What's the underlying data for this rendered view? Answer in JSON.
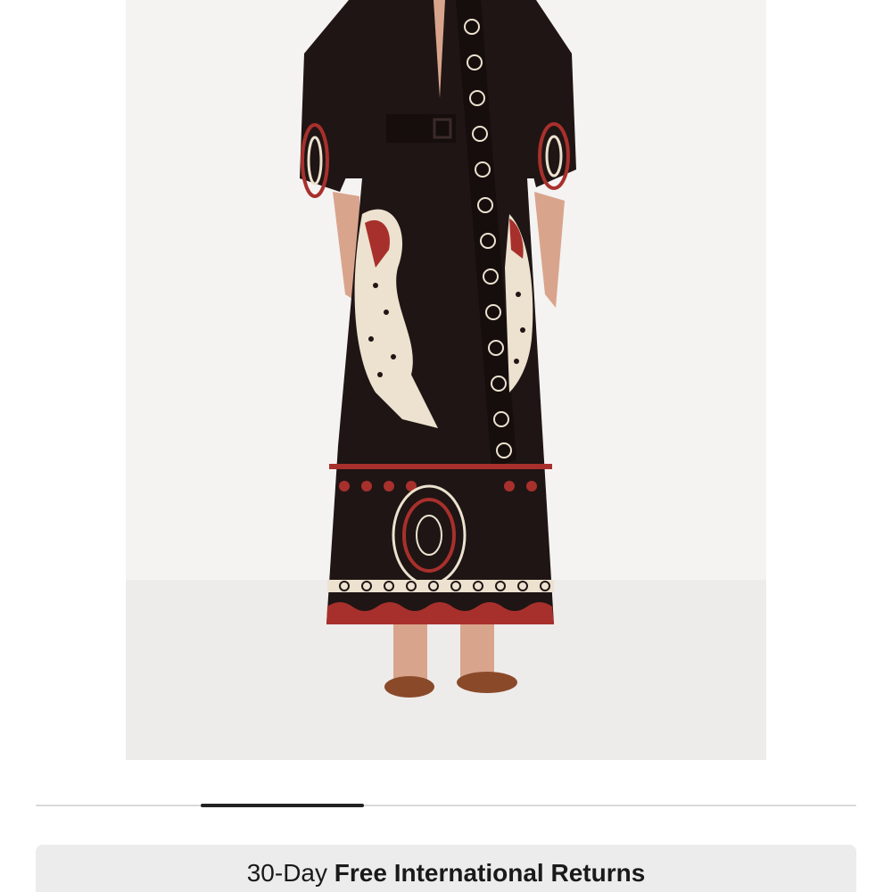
{
  "product_image": {
    "alt": "Black maxi dress with leopard and medallion print, belted waist, tie neck scarf",
    "colors": {
      "background": "#f4f3f2",
      "dress": "#1f1514",
      "print_red": "#a8302c",
      "print_cream": "#ece2cf",
      "skin": "#d9a48c"
    }
  },
  "carousel": {
    "progress_fraction": 0.2
  },
  "returns_banner": {
    "prefix": "30-Day",
    "highlight": "Free International Returns"
  }
}
